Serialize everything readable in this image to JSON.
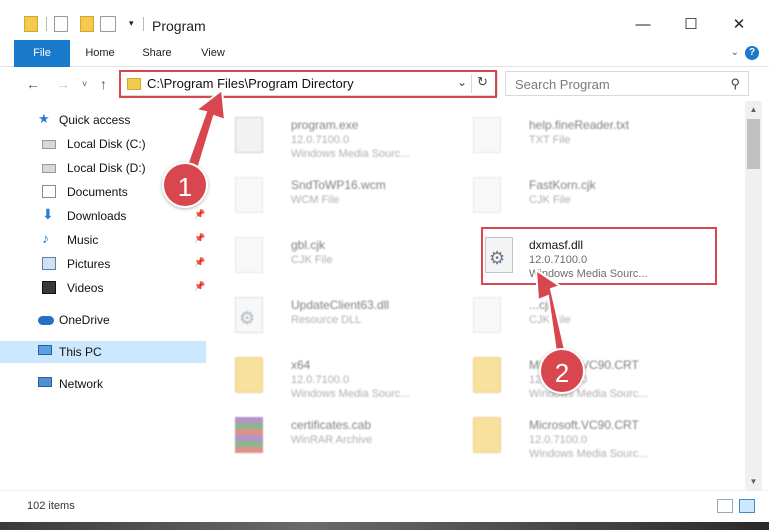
{
  "window": {
    "title": "Program",
    "min_icon": "minimize-icon",
    "max_icon": "maximize-icon",
    "close_icon": "close-icon"
  },
  "ribbon": {
    "tabs": [
      "File",
      "Home",
      "Share",
      "View"
    ]
  },
  "nav": {
    "address": "C:\\Program Files\\Program Directory",
    "search_placeholder": "Search Program"
  },
  "sidebar": {
    "quick_access": "Quick access",
    "items": [
      {
        "label": "Local Disk (C:)",
        "icon": "drive-icon",
        "pinned": false
      },
      {
        "label": "Local Disk (D:)",
        "icon": "drive-icon",
        "pinned": false
      },
      {
        "label": "Documents",
        "icon": "documents-icon",
        "pinned": false
      },
      {
        "label": "Downloads",
        "icon": "downloads-icon",
        "pinned": true
      },
      {
        "label": "Music",
        "icon": "music-icon",
        "pinned": true
      },
      {
        "label": "Pictures",
        "icon": "pictures-icon",
        "pinned": true
      },
      {
        "label": "Videos",
        "icon": "videos-icon",
        "pinned": true
      }
    ],
    "onedrive": "OneDrive",
    "this_pc": "This PC",
    "network": "Network"
  },
  "files": [
    {
      "name": "program.exe",
      "version": "12.0.7100.0",
      "type": "Windows Media Sourc...",
      "icon": "exe-icon",
      "focused": false
    },
    {
      "name": "help.fineReader.txt",
      "version": "TXT File",
      "type": "",
      "icon": "text-file-icon",
      "focused": false
    },
    {
      "name": "SndToWP16.wcm",
      "version": "WCM File",
      "type": "",
      "icon": "file-icon",
      "focused": false
    },
    {
      "name": "FastKorn.cjk",
      "version": "CJK File",
      "type": "",
      "icon": "file-icon",
      "focused": false
    },
    {
      "name": "gbl.cjk",
      "version": "CJK File",
      "type": "",
      "icon": "file-icon",
      "focused": false
    },
    {
      "name": "dxmasf.dll",
      "version": "12.0.7100.0",
      "type": "Windows Media Sourc...",
      "icon": "dll-gear-icon",
      "focused": true
    },
    {
      "name": "UpdateClient63.dll",
      "version": "Resource DLL",
      "type": "",
      "icon": "dll-gear-icon",
      "focused": false
    },
    {
      "name": "...cjk",
      "version": "CJK File",
      "type": "",
      "icon": "file-icon",
      "focused": false
    },
    {
      "name": "x64",
      "version": "12.0.7100.0",
      "type": "Windows Media Sourc...",
      "icon": "folder-icon",
      "focused": false
    },
    {
      "name": "Microsoft.VC90.CRT",
      "version": "12.0.7100.0",
      "type": "Windows Media Sourc...",
      "icon": "folder-icon",
      "focused": false
    },
    {
      "name": "certificates.cab",
      "version": "WinRAR Archive",
      "type": "",
      "icon": "archive-icon",
      "focused": false
    },
    {
      "name": "Microsoft.VC90.CRT",
      "version": "12.0.7100.0",
      "type": "Windows Media Sourc...",
      "icon": "folder-icon",
      "focused": false
    }
  ],
  "status": {
    "item_count": "102 items"
  },
  "callouts": [
    "1",
    "2"
  ],
  "colors": {
    "accent": "#1979ca",
    "highlight": "#d9474e",
    "selected": "#cce8ff"
  }
}
